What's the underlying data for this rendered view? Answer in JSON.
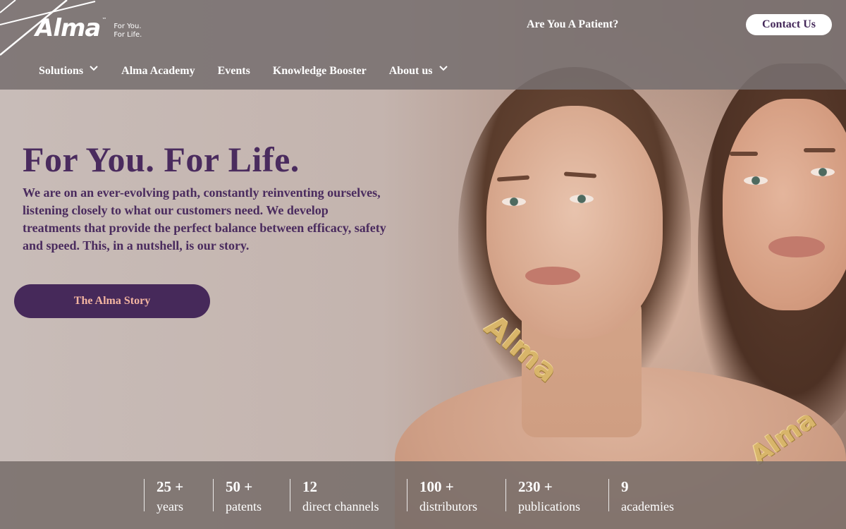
{
  "brand": {
    "logo_word": "Alma",
    "logo_tm": "™",
    "tagline_line1": "For You.",
    "tagline_line2": "For Life."
  },
  "header": {
    "patient_link": "Are You A Patient?",
    "contact_button": "Contact Us"
  },
  "nav": {
    "items": [
      {
        "label": "Solutions",
        "has_dropdown": true
      },
      {
        "label": "Alma Academy",
        "has_dropdown": false
      },
      {
        "label": "Events",
        "has_dropdown": false
      },
      {
        "label": "Knowledge Booster",
        "has_dropdown": false
      },
      {
        "label": "About us",
        "has_dropdown": true
      }
    ]
  },
  "hero": {
    "title": "For You. For Life.",
    "description": "We are on an ever-evolving path, constantly reinventing ourselves, listening closely to what our customers need. We develop treatments that provide the perfect balance between efficacy, safety and speed. This, in a nutshell, is our story.",
    "cta_label": "The Alma Story",
    "ring_text": "Alma"
  },
  "stats": [
    {
      "value": "25 +",
      "label": "years"
    },
    {
      "value": "50 +",
      "label": "patents"
    },
    {
      "value": "12",
      "label": "direct channels"
    },
    {
      "value": "100 +",
      "label": "distributors"
    },
    {
      "value": "230 +",
      "label": "publications"
    },
    {
      "value": "9",
      "label": "academies"
    }
  ],
  "colors": {
    "brand_purple": "#4a2b5e",
    "button_purple": "#46295a",
    "cta_text_peach": "#f3b5a1",
    "header_overlay": "#787070"
  }
}
